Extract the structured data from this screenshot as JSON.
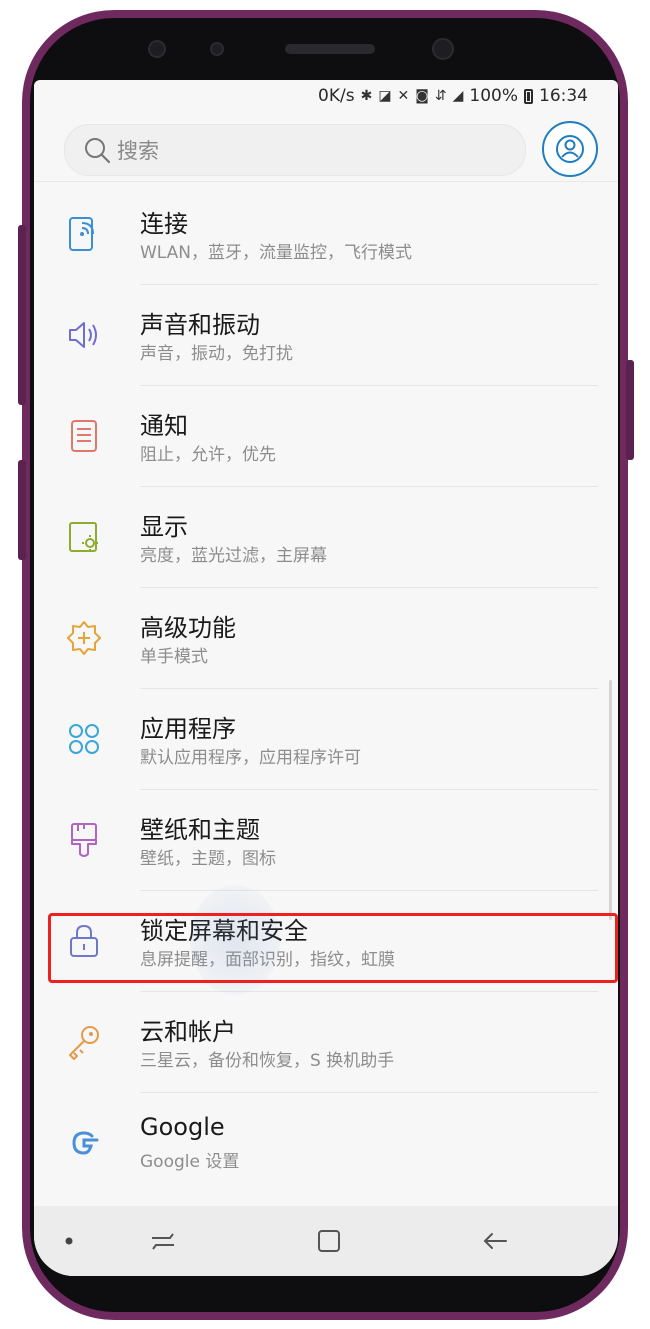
{
  "status_bar": {
    "speed": "0K/s",
    "battery": "100%",
    "time": "16:34"
  },
  "search": {
    "placeholder": "搜索"
  },
  "settings": [
    {
      "title": "连接",
      "subtitle": "WLAN，蓝牙，流量监控，飞行模式",
      "icon": "connection-icon",
      "color": "#3a8fd6"
    },
    {
      "title": "声音和振动",
      "subtitle": "声音，振动，免打扰",
      "icon": "speaker-icon",
      "color": "#6f6fcf"
    },
    {
      "title": "通知",
      "subtitle": "阻止，允许，优先",
      "icon": "notification-icon",
      "color": "#e0776b"
    },
    {
      "title": "显示",
      "subtitle": "亮度，蓝光过滤，主屏幕",
      "icon": "display-icon",
      "color": "#8dab2f"
    },
    {
      "title": "高级功能",
      "subtitle": "单手模式",
      "icon": "advanced-gear-icon",
      "color": "#e5a43a"
    },
    {
      "title": "应用程序",
      "subtitle": "默认应用程序，应用程序许可",
      "icon": "apps-grid-icon",
      "color": "#3aa7d6"
    },
    {
      "title": "壁纸和主题",
      "subtitle": "壁纸，主题，图标",
      "icon": "brush-icon",
      "color": "#b065c1"
    },
    {
      "title": "锁定屏幕和安全",
      "subtitle": "息屏提醒，面部识别，指纹，虹膜",
      "icon": "lock-icon",
      "color": "#6f77c8"
    },
    {
      "title": "云和帐户",
      "subtitle": "三星云，备份和恢复，S 换机助手",
      "icon": "key-icon",
      "color": "#e59a4a"
    },
    {
      "title": "Google",
      "subtitle": "Google 设置",
      "icon": "google-icon",
      "color": "#4a90d9"
    }
  ],
  "colors": {
    "highlight": "#ef2020",
    "phone_frame": "#6e2a5f"
  }
}
